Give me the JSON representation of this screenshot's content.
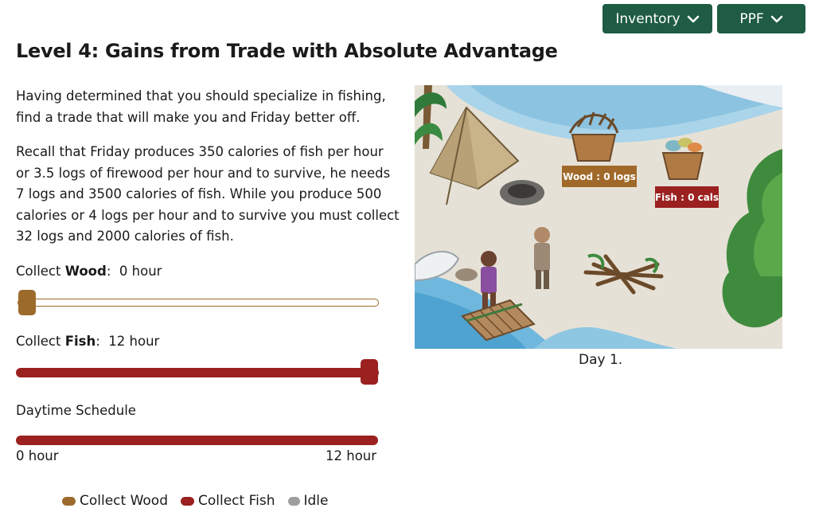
{
  "header": {
    "inventory_label": "Inventory",
    "ppf_label": "PPF"
  },
  "title": "Level 4: Gains from Trade with Absolute Advantage",
  "intro": {
    "line1": "Having determined that you should specialize in fishing,",
    "line2": "find a trade that will make you and Friday better off."
  },
  "recall": {
    "line1": "Recall that Friday produces 350 calories of fish per hour",
    "line2": "or 3.5 logs of firewood per hour and to survive, he needs",
    "line3": "7 logs and 3500 calories of fish. While you produce 500",
    "line4": "calories or 4 logs per hour and to survive you must collect",
    "line5": "32 logs and 2000 calories of fish."
  },
  "wood_slider": {
    "label_prefix": "Collect ",
    "label_bold": "Wood",
    "label_suffix": ":  0 hour",
    "value_hours": 0,
    "max_hours": 12
  },
  "fish_slider": {
    "label_prefix": "Collect ",
    "label_bold": "Fish",
    "label_suffix": ":  12 hour",
    "value_hours": 12,
    "max_hours": 12
  },
  "schedule": {
    "label": "Daytime Schedule",
    "start": "0 hour",
    "end": "12 hour"
  },
  "legend": {
    "wood": "Collect Wood",
    "fish": "Collect Fish",
    "idle": "Idle"
  },
  "scene": {
    "wood_tag": "Wood : 0 logs",
    "fish_tag": "Fish : 0 cals",
    "day": "Day 1."
  },
  "colors": {
    "button_green": "#1f5c43",
    "wood_brown": "#9c6b2c",
    "fish_red": "#9b2020",
    "idle_gray": "#9e9e9e",
    "wood_tag_bg": "#a0692a",
    "fish_tag_bg": "#9b2020"
  }
}
